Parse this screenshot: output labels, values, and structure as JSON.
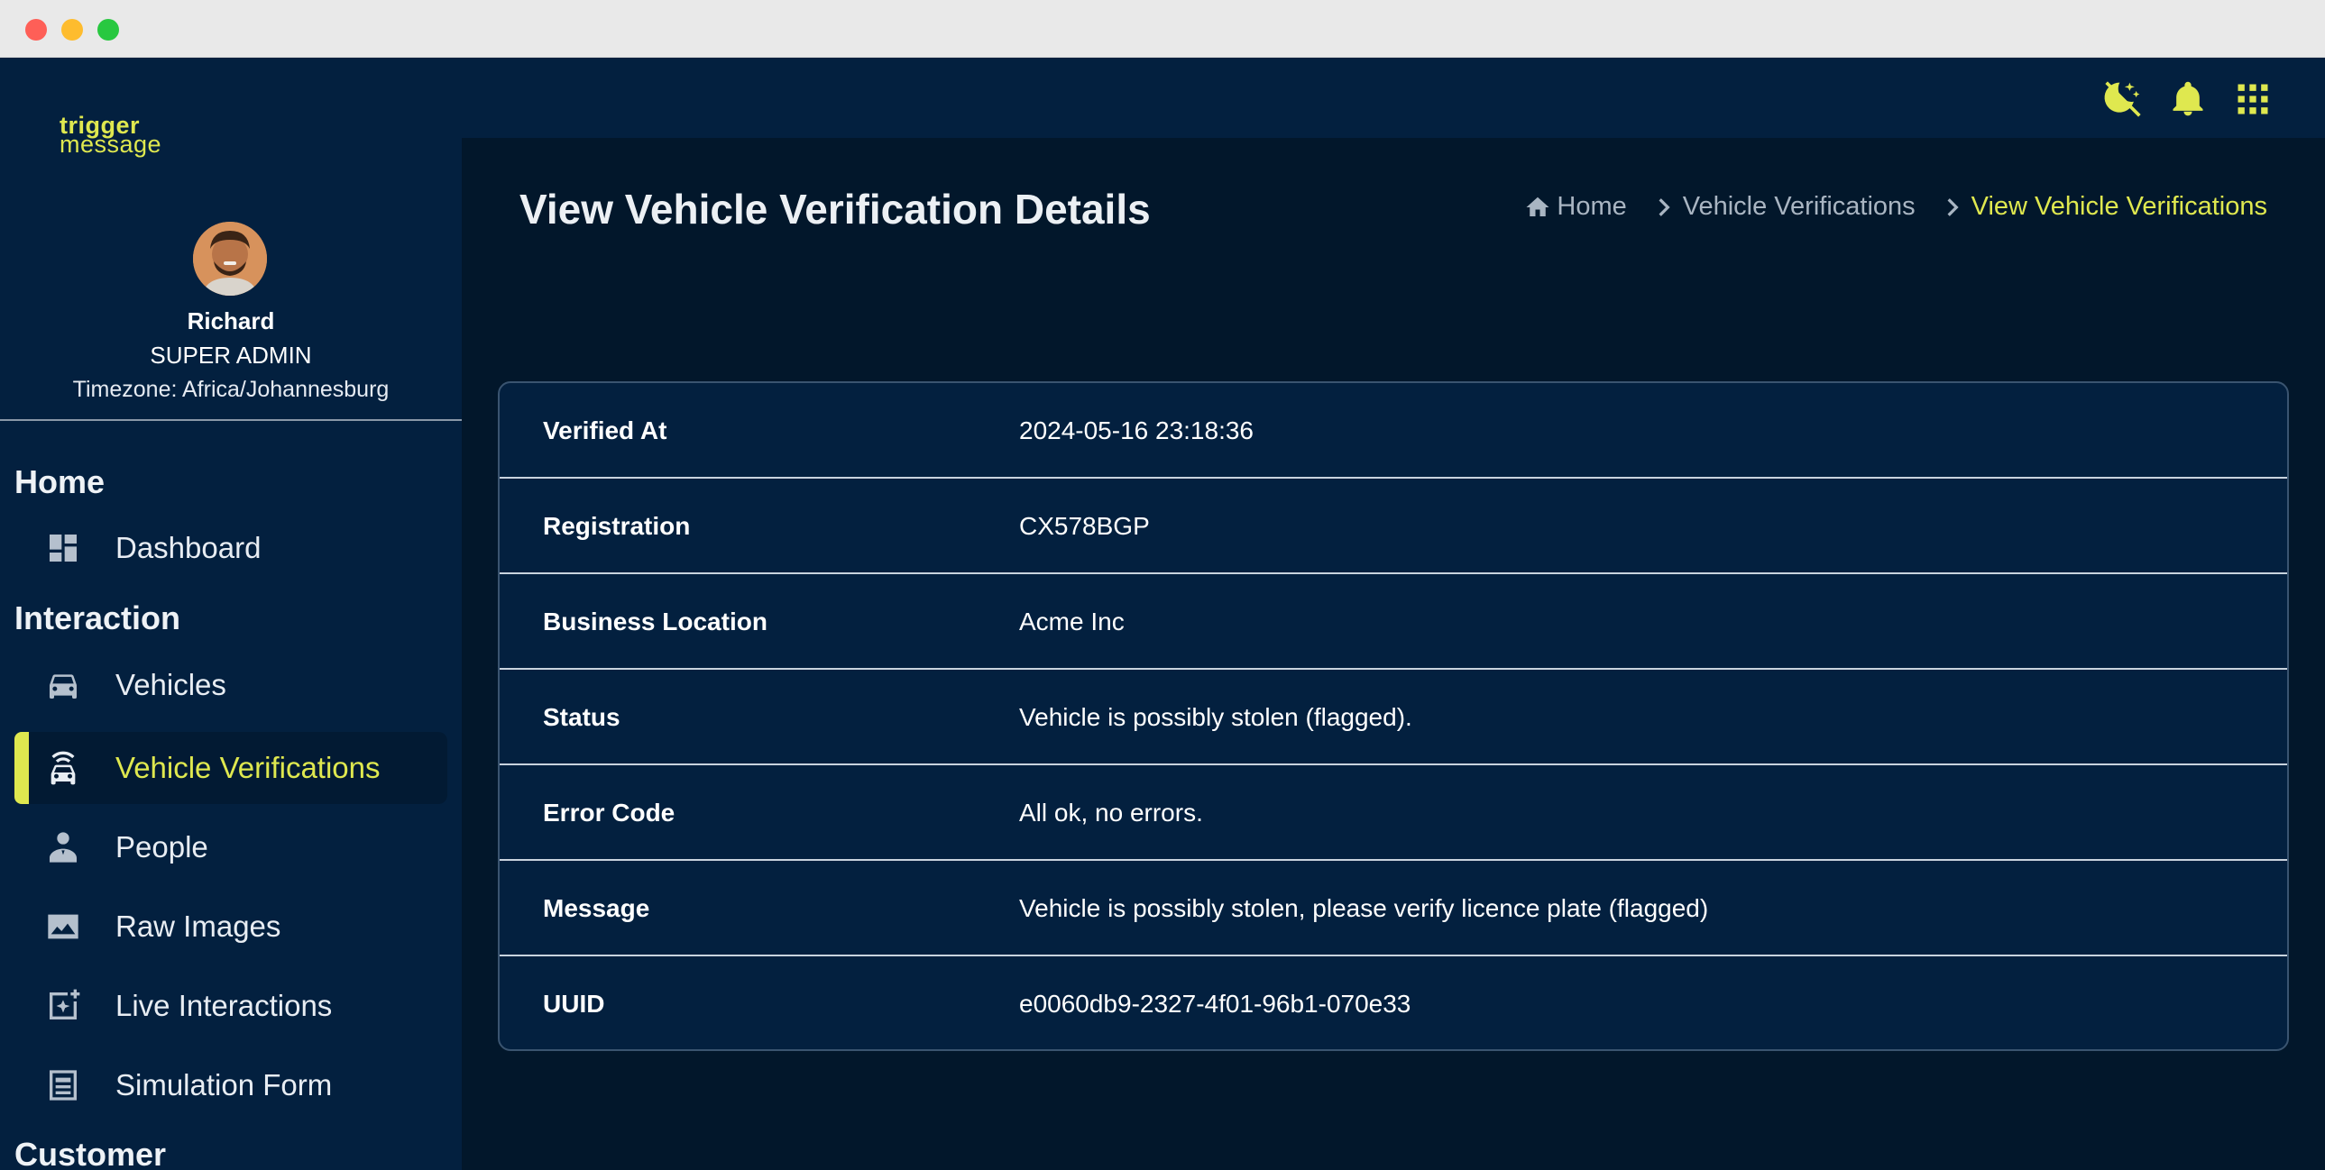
{
  "window": {
    "controls": [
      "close",
      "minimize",
      "maximize"
    ]
  },
  "brand": {
    "line1": "trigger",
    "line2": "message",
    "accent": "#dfe84f"
  },
  "topbar": {
    "icons": [
      "theme-toggle-icon",
      "notification-bell-icon",
      "apps-grid-icon"
    ]
  },
  "user": {
    "name": "Richard",
    "role": "SUPER ADMIN",
    "timezone": "Timezone: Africa/Johannesburg"
  },
  "sidebar": {
    "sections": [
      {
        "title": "Home"
      },
      {
        "title": "Interaction"
      },
      {
        "title": "Customer"
      }
    ],
    "items": [
      {
        "label": "Dashboard",
        "icon": "dashboard-icon"
      },
      {
        "label": "Vehicles",
        "icon": "car-icon"
      },
      {
        "label": "Vehicle Verifications",
        "icon": "car-signal-icon",
        "active": true
      },
      {
        "label": "People",
        "icon": "person-icon"
      },
      {
        "label": "Raw Images",
        "icon": "image-icon"
      },
      {
        "label": "Live Interactions",
        "icon": "sparkle-add-icon"
      },
      {
        "label": "Simulation Form",
        "icon": "form-icon"
      }
    ]
  },
  "page": {
    "title": "View Vehicle Verification Details",
    "breadcrumb": [
      "Home",
      "Vehicle Verifications",
      "View Vehicle Verifications"
    ]
  },
  "details": [
    {
      "key": "Verified At",
      "value": "2024-05-16 23:18:36"
    },
    {
      "key": "Registration",
      "value": "CX578BGP"
    },
    {
      "key": "Business Location",
      "value": "Acme Inc"
    },
    {
      "key": "Status",
      "value": "Vehicle is possibly stolen (flagged)."
    },
    {
      "key": "Error Code",
      "value": "All ok, no errors."
    },
    {
      "key": "Message",
      "value": "Vehicle is possibly stolen, please verify licence plate (flagged)"
    },
    {
      "key": "UUID",
      "value": "e0060db9-2327-4f01-96b1-070e33"
    }
  ]
}
